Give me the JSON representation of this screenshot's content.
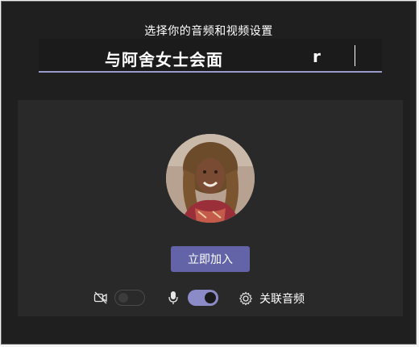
{
  "dialog": {
    "subtitle": "选择你的音频和视频设置",
    "meeting_title": "与阿舍女士会面",
    "meeting_title_suffix": "r"
  },
  "preview": {
    "avatar_icon": "user-avatar-photo"
  },
  "actions": {
    "join_label": "立即加入"
  },
  "controls": {
    "camera_icon": "camera-off-icon",
    "camera_on": false,
    "mic_icon": "microphone-icon",
    "mic_on": true,
    "settings_icon": "gear-icon",
    "audio_label": "关联音频"
  },
  "colors": {
    "accent": "#6264a7",
    "toggle_on": "#8b8cc7",
    "background": "#1f1f1f",
    "panel": "#292929"
  }
}
